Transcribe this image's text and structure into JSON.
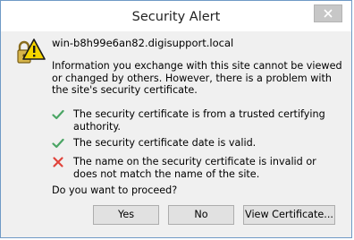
{
  "dialog": {
    "title": "Security Alert",
    "icons": {
      "header": "lock-warning-icon",
      "close": "close-icon",
      "valid": "check-icon",
      "invalid": "x-icon"
    },
    "colors": {
      "check": "#4aa564",
      "error": "#e0433b",
      "warning_yellow": "#f5d400",
      "lock": "#d7b54a",
      "border": "#6f9ac6"
    },
    "host": "win-b8h99e6an82.digisupport.local",
    "info": "Information you exchange with this site cannot be viewed or changed by others. However, there is a problem with the site's security certificate.",
    "checks": [
      {
        "text": "The security certificate is from a trusted certifying authority.",
        "status": "valid"
      },
      {
        "text": "The security certificate date is valid.",
        "status": "valid"
      },
      {
        "text": "The name on the security certificate is invalid or does not match the name of the site.",
        "status": "invalid"
      }
    ],
    "question": "Do you want to proceed?",
    "buttons": {
      "yes": "Yes",
      "no": "No",
      "view_certificate": "View Certificate..."
    }
  }
}
